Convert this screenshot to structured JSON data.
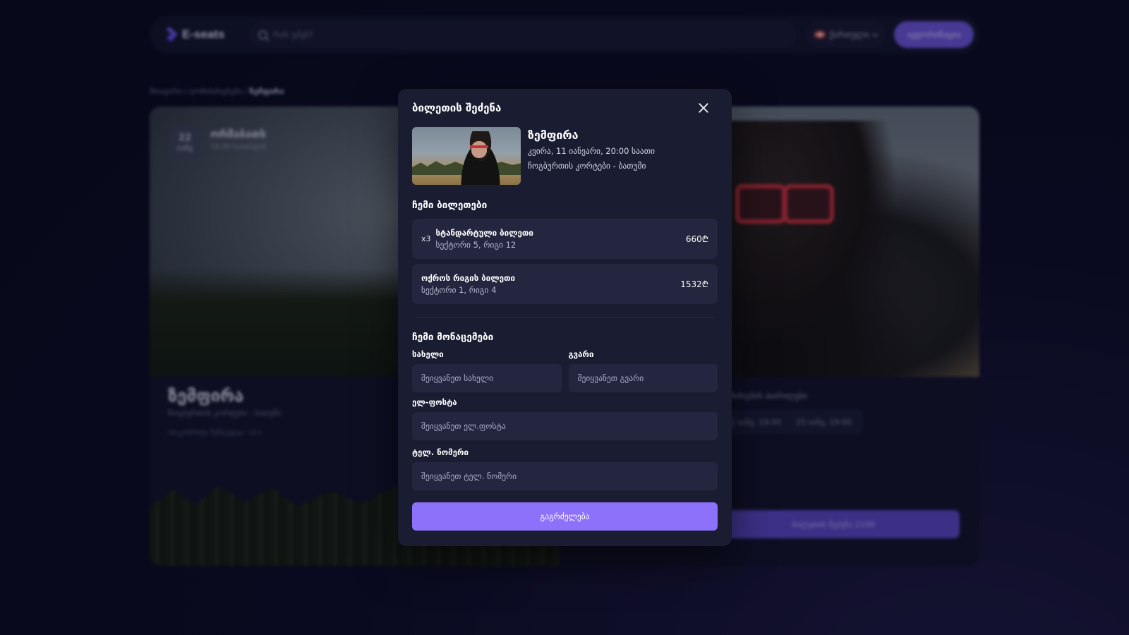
{
  "header": {
    "logo_text": "E-seats",
    "search_placeholder": "რას ეძებ?",
    "language": "ქართული",
    "auth_button": "ავტორიზაცია"
  },
  "breadcrumb": {
    "items": [
      "მთავარი",
      "ღონისძიებები"
    ],
    "current": "ზემფირა"
  },
  "background_event": {
    "badge_day": "22",
    "badge_month": "იანვ",
    "weekday": "ორშაბათს",
    "time": "18:00 საათიდან",
    "title": "ზემფირა",
    "location": "ჩოგბურთის კორტები - ბათუმი",
    "age_limit": "ასაკობრივი შეზღუდვა: 12+",
    "dates_title": "ღონისძიების თარიღები",
    "date_1": "22 იანვ, 19:00",
    "date_2": "25 იანვ, 19:00",
    "buy_button": "ბილეთის შეძენა 2100"
  },
  "modal": {
    "title": "ბილეთის შეძენა",
    "event": {
      "name": "ზემფირა",
      "date": "კვირა, 11 იანვარი, 20:00 საათი",
      "venue": "ჩოგბურთის კორტები - ბათუმი"
    },
    "tickets_title": "ჩემი ბილეთები",
    "tickets": [
      {
        "qty": "x3",
        "name": "სტანდარტული ბილეთი",
        "seat": "სექტორი 5, რიგი 12",
        "price": "660₾"
      },
      {
        "qty": "",
        "name": "ოქროს რიგის ბილეთი",
        "seat": "სექტორი 1, რიგი 4",
        "price": "1532₾"
      }
    ],
    "data_title": "ჩემი მონაცემები",
    "fields": {
      "first_name_label": "სახელი",
      "first_name_placeholder": "შეიყვანეთ სახელი",
      "last_name_label": "გვარი",
      "last_name_placeholder": "შეიყვანეთ გვარი",
      "email_label": "ელ-ფოსტა",
      "email_placeholder": "შეიყვანეთ ელ.ფოსტა",
      "phone_label": "ტელ. ნომერი",
      "phone_placeholder": "შეიყვანეთ ტელ. ნომერი"
    },
    "submit_label": "გაგრძელება"
  },
  "colors": {
    "accent": "#8d71fb",
    "modal_bg": "#1a1c32",
    "input_bg": "#24263f"
  }
}
